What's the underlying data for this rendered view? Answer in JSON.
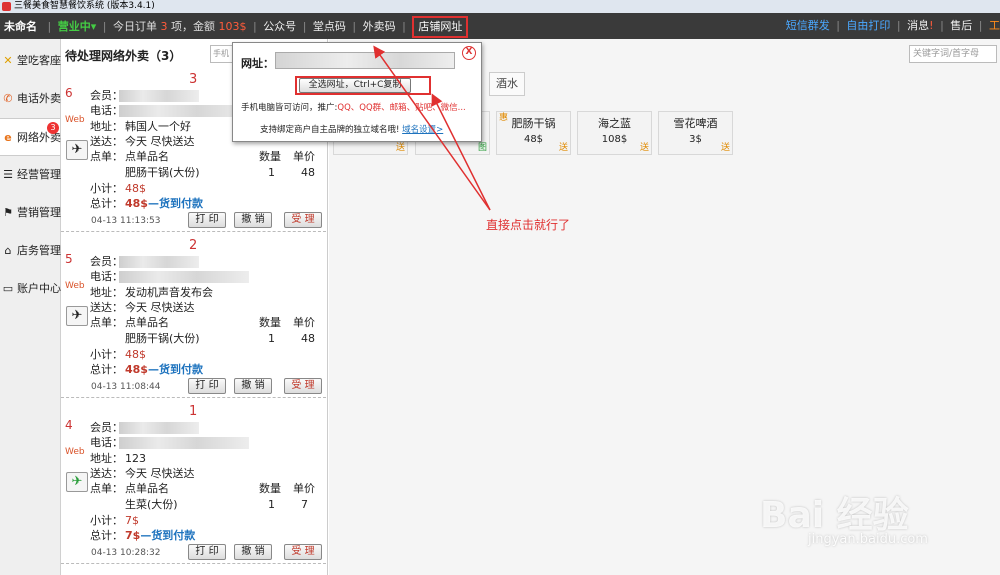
{
  "window_title": "三餐美食智慧餐饮系统 (版本3.4.1)",
  "topbar": {
    "shop_name": "未命名",
    "status": "营业中▾",
    "today_orders_prefix": "今日订单",
    "order_count": "3",
    "amount_text": "项，金额",
    "amount": "103$",
    "public_account": "公众号",
    "hall_code": "堂点码",
    "takeout_code": "外卖码",
    "store_url": "店铺网址",
    "sms": "短信群发",
    "custom_print": "自由打印",
    "messages": "消息",
    "after_sale": "售后",
    "work": "工"
  },
  "sidebar": {
    "items": [
      {
        "label": "堂吃客座",
        "icon": "dine-in-icon"
      },
      {
        "label": "电话外卖",
        "icon": "phone-icon"
      },
      {
        "label": "网络外卖",
        "icon": "web-icon",
        "badge": "3"
      },
      {
        "label": "经营管理",
        "icon": "list-icon"
      },
      {
        "label": "营销管理",
        "icon": "flag-icon"
      },
      {
        "label": "店务管理",
        "icon": "home-icon"
      },
      {
        "label": "账户中心",
        "icon": "monitor-icon"
      }
    ]
  },
  "orders": {
    "title": "待处理网络外卖（3）",
    "search_placeholder": "手机",
    "labels": {
      "member": "会员：",
      "phone": "电话：",
      "address": "地址：",
      "delivery": "送达：",
      "order": "点单：",
      "dish_name": "点单品名",
      "qty": "数量",
      "unit_price": "单价",
      "subtotal": "小计：",
      "total": "总计：",
      "print": "打 印",
      "cancel": "撤 销",
      "accept": "受 理"
    },
    "list": [
      {
        "number": "3",
        "seq": "6",
        "source": "Web",
        "address": "韩国人一个好",
        "delivery": "今天 尽快送达",
        "dish": "肥肠干锅(大份)",
        "qty": "1",
        "price": "48",
        "subtotal": "48$",
        "total": "48$",
        "payment": "—货到付款",
        "time": "04-13 11:13:53"
      },
      {
        "number": "2",
        "seq": "5",
        "source": "Web",
        "address": "发动机声音发布会",
        "delivery": "今天 尽快送达",
        "dish": "肥肠干锅(大份)",
        "qty": "1",
        "price": "48",
        "subtotal": "48$",
        "total": "48$",
        "payment": "—货到付款",
        "time": "04-13 11:08:44"
      },
      {
        "number": "1",
        "seq": "4",
        "source": "Web",
        "address": "123",
        "delivery": "今天 尽快送达",
        "dish": "生菜(大份)",
        "qty": "1",
        "price": "7",
        "subtotal": "7$",
        "total": "7$",
        "payment": "—货到付款",
        "time": "04-13 10:28:32"
      }
    ]
  },
  "menu": {
    "keyword_placeholder": "关键字词/首字母",
    "category_active": "酒水",
    "partial_tags": [
      "送",
      "图",
      "图"
    ],
    "items": [
      {
        "name": "肥肠干锅",
        "price": "48$",
        "tag": "送",
        "promo": "惠"
      },
      {
        "name": "海之蓝",
        "price": "108$",
        "tag": "送",
        "promo": ""
      },
      {
        "name": "雪花啤酒",
        "price": "3$",
        "tag": "送",
        "promo": ""
      }
    ]
  },
  "popup": {
    "url_label": "网址：",
    "copy_button": "全选网址，Ctrl+C复制",
    "line1_prefix": "手机电脑皆可访问，推广:",
    "line1_links": "QQ、QQ群、邮箱、贴吧、微信...",
    "line2_prefix": "支持绑定商户自主品牌的独立域名哦!",
    "line2_link": "域名设置>",
    "close": "X"
  },
  "annotation": "直接点击就行了",
  "watermark": {
    "main": "Bai 经验",
    "sub": "jingyan.baidu.com"
  },
  "colors": {
    "accent_red": "#e03030",
    "topbar_bg": "#3a3a3a",
    "status_green": "#44cc44",
    "link_blue": "#1e73be"
  }
}
